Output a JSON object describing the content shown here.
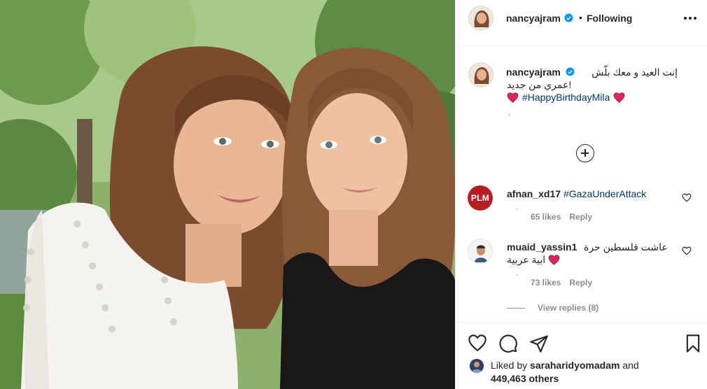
{
  "post": {
    "photo_alt": "Photo"
  },
  "header": {
    "username": "nancyajram",
    "separator": "•",
    "follow_status": "Following"
  },
  "caption": {
    "username": "nancyajram",
    "line1": "إنت العيد و معك بلّش",
    "line2": "!عمري من جديد",
    "hashtag": "#HappyBirthdayMila",
    "small_mark": "،"
  },
  "comments": [
    {
      "username": "afnan_xd17",
      "text": "#GazaUnderAttack",
      "avatar_text": "PLM",
      "likes": "65 likes",
      "reply": "Reply"
    },
    {
      "username": "muaid_yassin1",
      "text_line1": "عاشت فلسطين حرة",
      "text_line2": "ابية عربية",
      "likes": "73 likes",
      "reply": "Reply",
      "view_replies": "View replies (8)"
    }
  ],
  "likes": {
    "prefix": "Liked by",
    "user": "saraharidyomadam",
    "and": "and",
    "count": "449,463 others"
  },
  "colors": {
    "link": "#00376b",
    "verified": "#0095f6",
    "heart": "#ed4956",
    "muted": "#8e8e8e"
  }
}
